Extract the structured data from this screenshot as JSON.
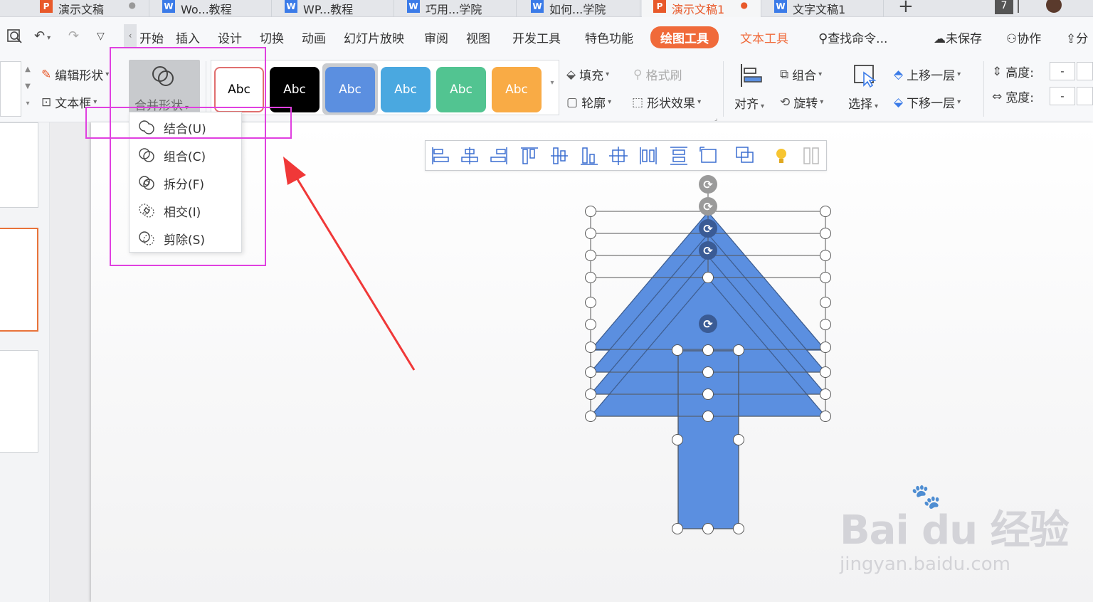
{
  "tabs": [
    {
      "label": "演示文稿",
      "type": "ppt"
    },
    {
      "label": "Wo...教程",
      "type": "word"
    },
    {
      "label": "WP...教程",
      "type": "word"
    },
    {
      "label": "巧用...学院",
      "type": "word"
    },
    {
      "label": "如何...学院",
      "type": "word"
    },
    {
      "label": "演示文稿1",
      "type": "ppt",
      "active": true
    },
    {
      "label": "文字文稿1",
      "type": "word"
    }
  ],
  "tab_add": "+",
  "tab_count": "7",
  "menu": {
    "items": [
      "开始",
      "插入",
      "设计",
      "切换",
      "动画",
      "幻灯片放映",
      "审阅",
      "视图",
      "开发工具",
      "特色功能"
    ],
    "drawing_tools": "绘图工具",
    "text_tools": "文本工具",
    "search": "查找命令...",
    "unsaved": "未保存",
    "collab": "协作",
    "share": "分"
  },
  "ribbon": {
    "edit_shape": "编辑形状",
    "text_box": "文本框",
    "merge_shapes": "合并形状",
    "style_samples": [
      "Abc",
      "Abc",
      "Abc",
      "Abc",
      "Abc",
      "Abc"
    ],
    "style_colors": [
      "#ffffff",
      "#000000",
      "#5b8fe0",
      "#4aa8e0",
      "#52c491",
      "#f9ab45"
    ],
    "fill": "填充",
    "format_painter": "格式刷",
    "outline": "轮廓",
    "shape_effects": "形状效果",
    "align": "对齐",
    "group": "组合",
    "rotate": "旋转",
    "select": "选择",
    "bring_forward": "上移一层",
    "send_backward": "下移一层",
    "height_label": "高度:",
    "width_label": "宽度:",
    "height_value": "-",
    "width_value": "-"
  },
  "dropdown": {
    "items": [
      "结合(U)",
      "组合(C)",
      "拆分(F)",
      "相交(I)",
      "剪除(S)"
    ]
  },
  "colors": {
    "accent": "#f06a3a",
    "shape": "#5b8fe0",
    "highlight": "#e040e0",
    "arrow": "#f03838"
  },
  "watermark": {
    "brand": "Bai du 经验",
    "url": "jingyan.baidu.com"
  }
}
